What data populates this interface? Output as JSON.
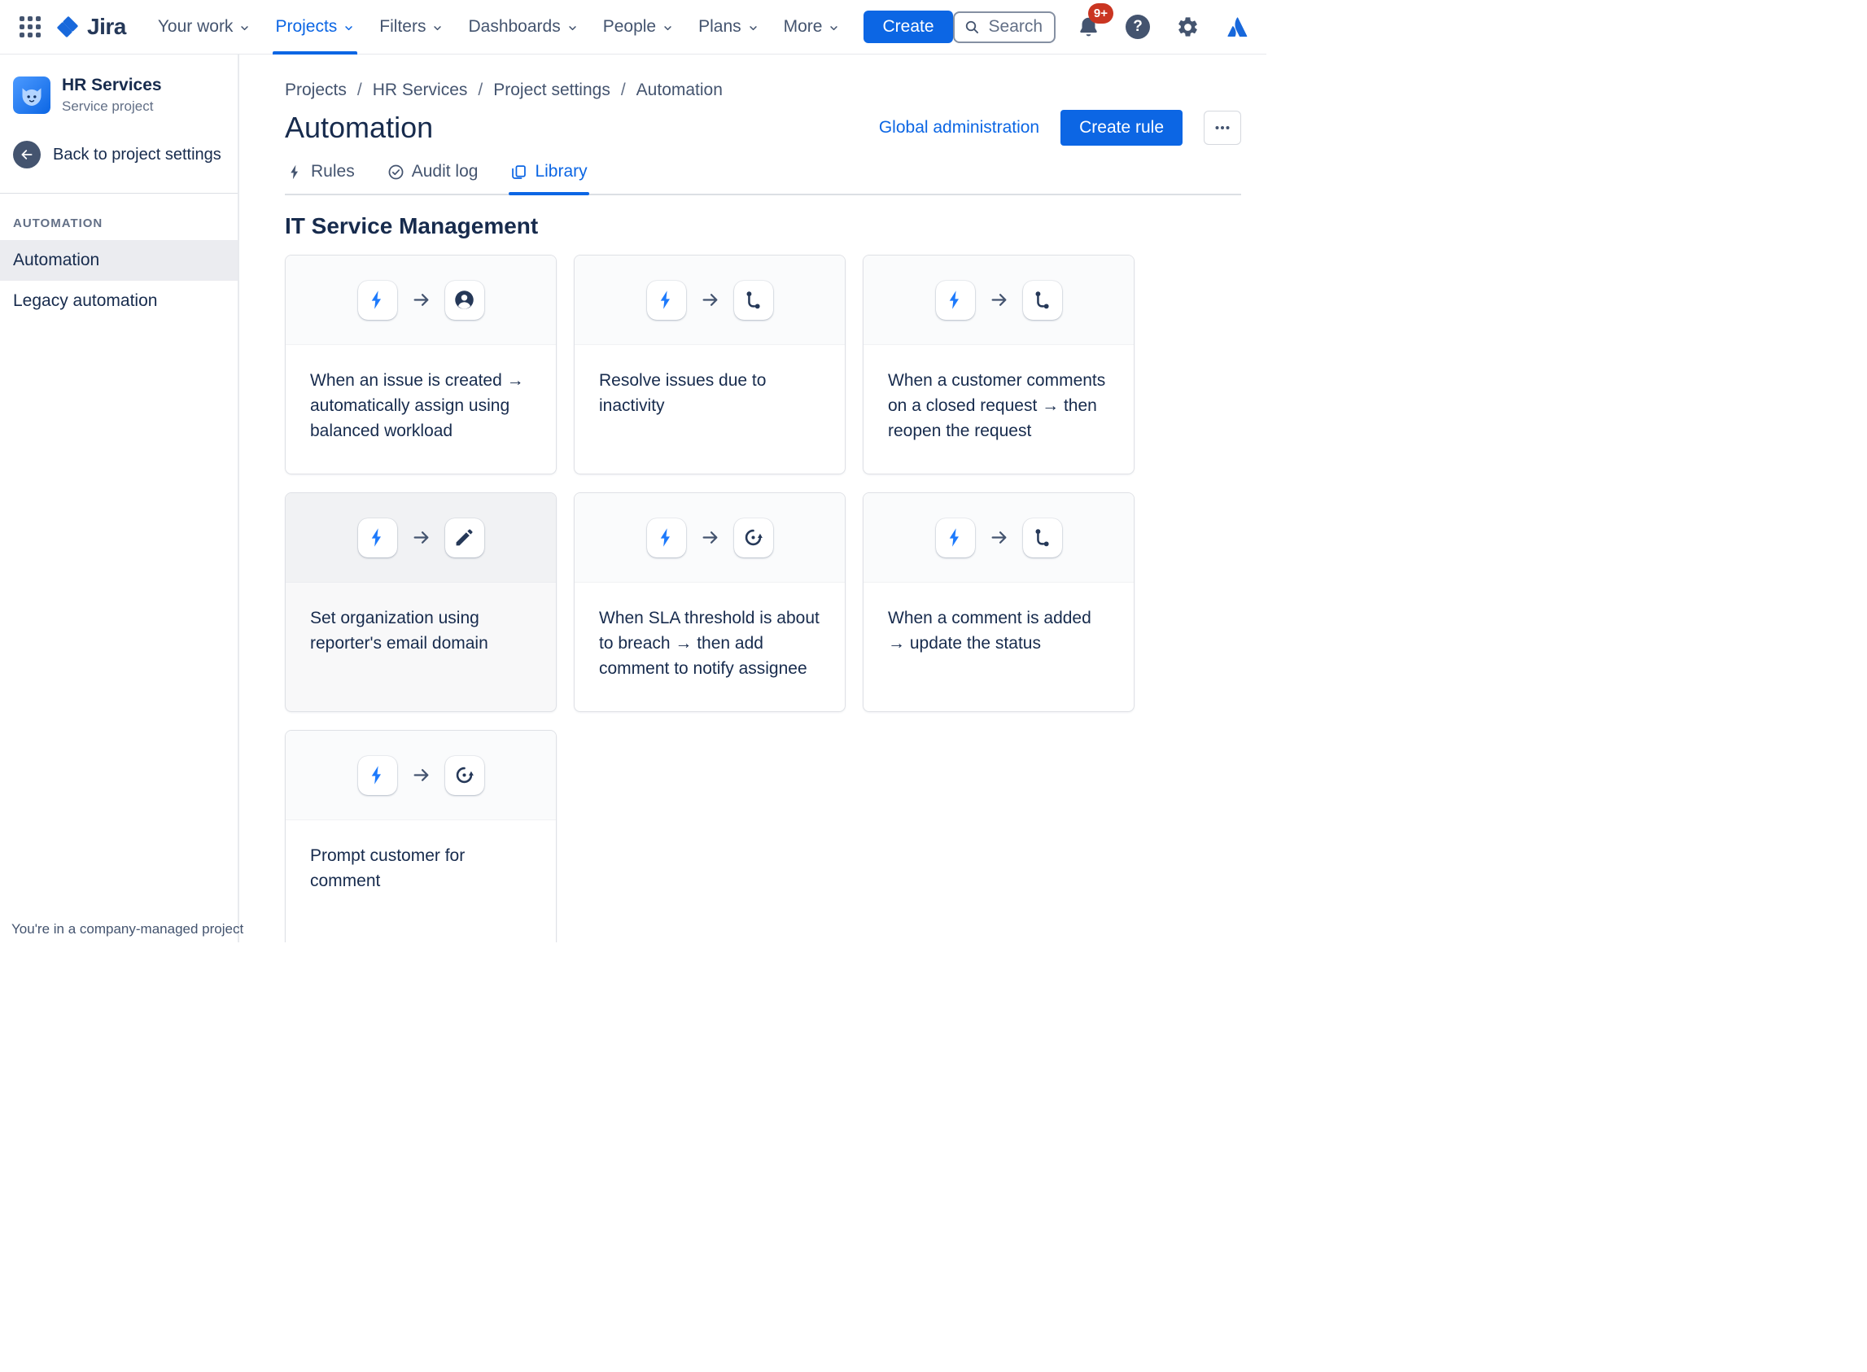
{
  "colors": {
    "brand_blue": "#0C66E4",
    "bolt_blue": "#1D7AFC",
    "nav_text": "#44546F",
    "heading_text": "#172B4D",
    "subtle_text": "#626F86",
    "border": "#DCDFE4",
    "selected_item_bg": "#EBECF0",
    "card_top_bg": "#FAFBFC",
    "notification_red": "#CA3521",
    "atlassian_blue": "#1868DB"
  },
  "nav": {
    "logo_text": "Jira",
    "items": [
      {
        "label": "Your work",
        "active": false
      },
      {
        "label": "Projects",
        "active": true
      },
      {
        "label": "Filters",
        "active": false
      },
      {
        "label": "Dashboards",
        "active": false
      },
      {
        "label": "People",
        "active": false
      },
      {
        "label": "Plans",
        "active": false
      },
      {
        "label": "More",
        "active": false
      }
    ],
    "create_button": "Create",
    "search_placeholder": "Search",
    "notifications_badge": "9+",
    "right_icons": [
      "bell-icon",
      "help-icon",
      "gear-icon",
      "atlassian-logo-icon"
    ]
  },
  "sidebar": {
    "project_name": "HR Services",
    "project_type": "Service project",
    "back_link": "Back to project settings",
    "section_title": "AUTOMATION",
    "items": [
      {
        "label": "Automation",
        "selected": true
      },
      {
        "label": "Legacy automation",
        "selected": false
      }
    ],
    "footer_note": "You're in a company-managed project"
  },
  "main": {
    "breadcrumbs": [
      "Projects",
      "HR Services",
      "Project settings",
      "Automation"
    ],
    "title": "Automation",
    "global_admin_link": "Global administration",
    "create_rule_button": "Create rule",
    "more_button_icon": "ellipsis-icon",
    "tabs": [
      {
        "label": "Rules",
        "icon": "lightning",
        "active": false
      },
      {
        "label": "Audit log",
        "icon": "check-circle",
        "active": false
      },
      {
        "label": "Library",
        "icon": "copy",
        "active": true
      }
    ],
    "section_title": "IT Service Management",
    "cards": [
      {
        "trigger_icon": "lightning",
        "action_icon": "person-circle",
        "text": "When an issue is created → automatically assign using balanced workload",
        "hover": false
      },
      {
        "trigger_icon": "lightning",
        "action_icon": "workflow",
        "text": "Resolve issues due to inactivity",
        "hover": false
      },
      {
        "trigger_icon": "lightning",
        "action_icon": "workflow",
        "text": "When a customer comments on a closed request → then reopen the request",
        "hover": false
      },
      {
        "trigger_icon": "lightning",
        "action_icon": "pencil",
        "text": "Set organization using reporter's email domain",
        "hover": true
      },
      {
        "trigger_icon": "lightning",
        "action_icon": "refresh",
        "text": "When SLA threshold is about to breach → then add comment to notify assignee",
        "hover": false
      },
      {
        "trigger_icon": "lightning",
        "action_icon": "workflow",
        "text": "When a comment is added → update the status",
        "hover": false
      },
      {
        "trigger_icon": "lightning",
        "action_icon": "refresh",
        "text": "Prompt customer for comment",
        "hover": false
      }
    ]
  }
}
